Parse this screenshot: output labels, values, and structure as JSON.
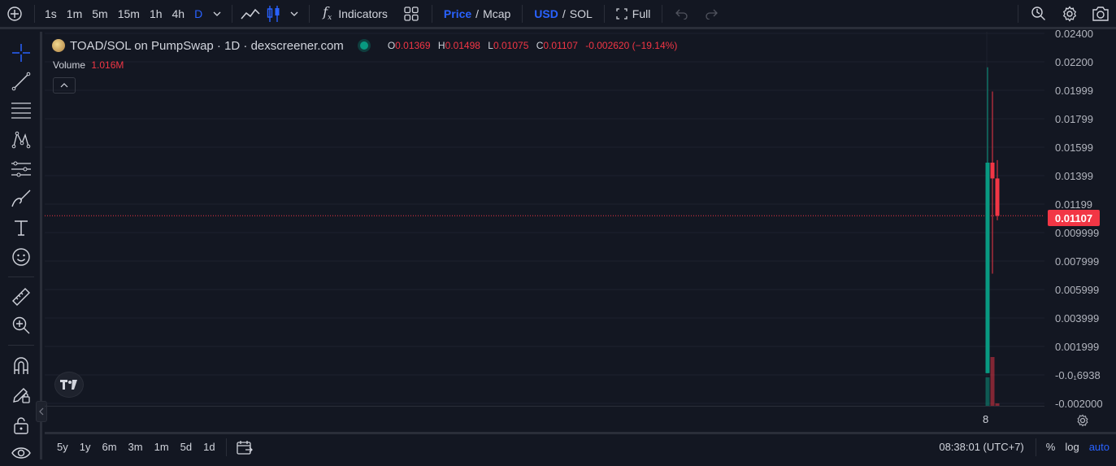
{
  "toolbar": {
    "intervals": [
      "1s",
      "1m",
      "5m",
      "15m",
      "1h",
      "4h",
      "D"
    ],
    "active_interval": "D",
    "indicators_label": "Indicators",
    "price_label": "Price",
    "slash": "/",
    "mcap_label": "Mcap",
    "usd_label": "USD",
    "sol_label": "SOL",
    "full_label": "Full"
  },
  "legend": {
    "symbol": "TOAD/SOL on PumpSwap · 1D · dexscreener.com",
    "o_label": "O",
    "o_value": "0.01369",
    "h_label": "H",
    "h_value": "0.01498",
    "l_label": "L",
    "l_value": "0.01075",
    "c_label": "C",
    "c_value": "0.01107",
    "change": "-0.002620 (−19.14%)",
    "volume_label": "Volume",
    "volume_value": "1.016M"
  },
  "price_axis": {
    "ticks": [
      "0.02400",
      "0.02200",
      "0.01999",
      "0.01799",
      "0.01599",
      "0.01399",
      "0.01199",
      "0.009999",
      "0.007999",
      "0.005999",
      "0.003999",
      "0.001999",
      "-0.0₁6938",
      "-0.002000"
    ],
    "current_price": "0.01107"
  },
  "time_axis": {
    "label": "8"
  },
  "bottom": {
    "ranges": [
      "5y",
      "1y",
      "6m",
      "3m",
      "1m",
      "5d",
      "1d"
    ],
    "time": "08:38:01 (UTC+7)",
    "percent": "%",
    "log": "log",
    "auto": "auto"
  },
  "colors": {
    "up": "#089981",
    "down": "#f23645",
    "accent": "#2962ff",
    "background": "#131722"
  },
  "chart_data": {
    "type": "candlestick",
    "candles": [
      {
        "open": 1e-05,
        "high": 0.0215,
        "low": 1e-05,
        "close": 0.0148,
        "volume_color": "up"
      },
      {
        "open": 0.0148,
        "high": 0.0198,
        "low": 0.007,
        "close": 0.01369,
        "volume_color": "down"
      },
      {
        "open": 0.01369,
        "high": 0.01498,
        "low": 0.01075,
        "close": 0.01107,
        "volume_color": "down"
      }
    ],
    "volume": [
      0.35,
      0.6,
      0.03
    ],
    "ylim": [
      -0.002,
      0.024
    ],
    "x_label": "8"
  }
}
